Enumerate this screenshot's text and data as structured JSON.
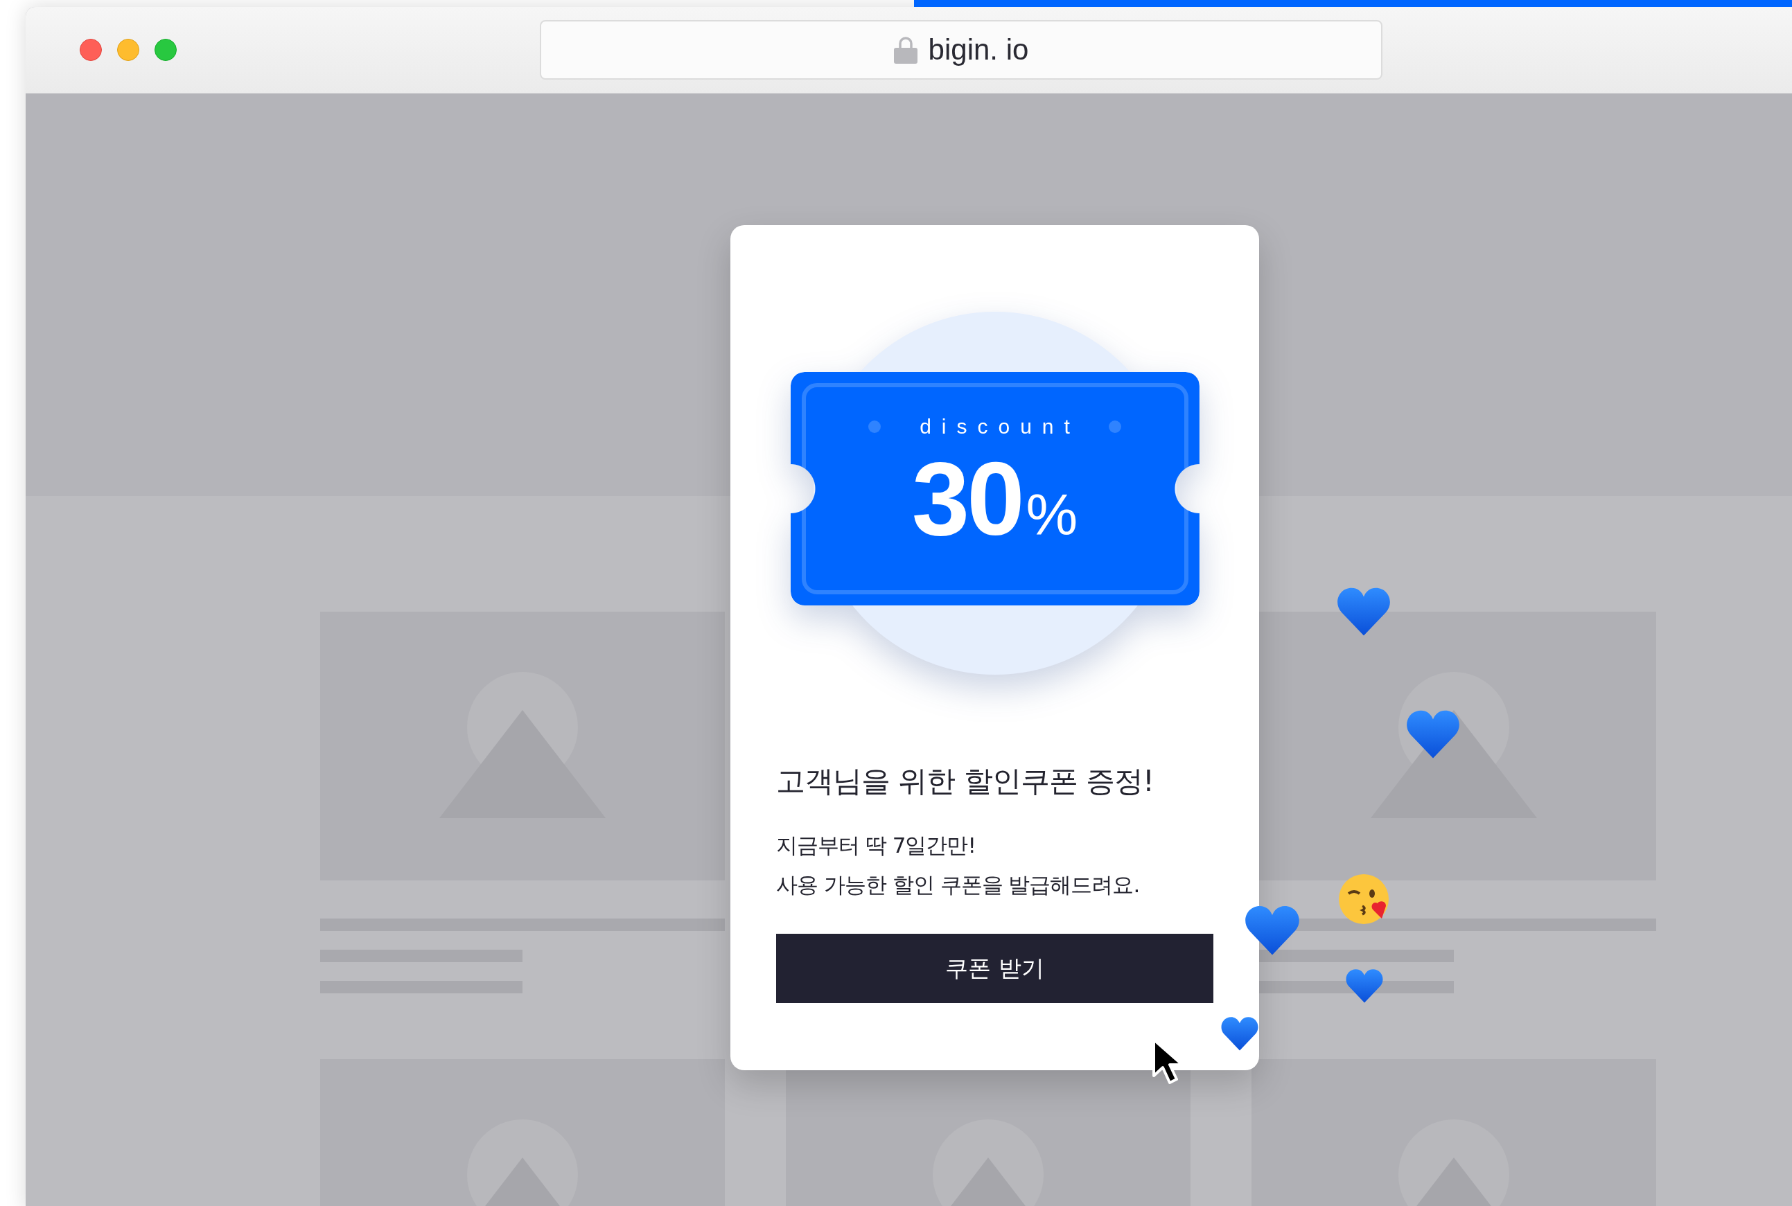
{
  "browser": {
    "address": "bigin. io",
    "loading_bar": {
      "level": 0.49
    }
  },
  "popup": {
    "coupon": {
      "label": "discount",
      "value": "30",
      "unit": "%"
    },
    "title": "고객님을 위한 할인쿠폰 증정!",
    "body": [
      "지금부터 딱 7일간만!",
      "사용 가능한 할인 쿠폰을 발급해드려요."
    ],
    "button": "쿠폰 받기"
  }
}
